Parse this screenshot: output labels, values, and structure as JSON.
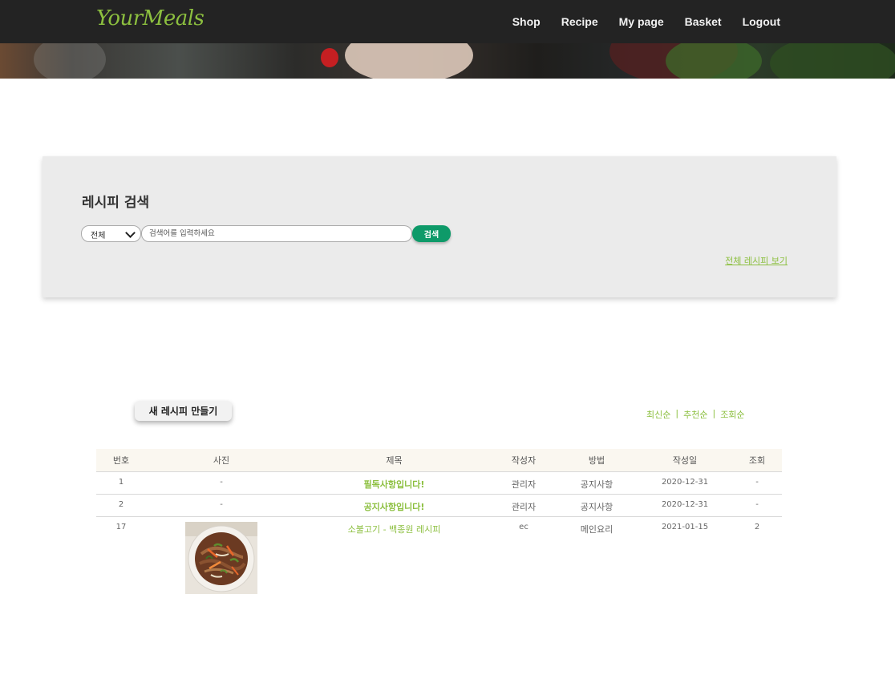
{
  "brand": {
    "logo": "YourMeals",
    "accent": "#8cbf3f",
    "button_green": "#0e9a69",
    "notice_red": "#e0405a"
  },
  "nav": {
    "items": [
      {
        "label": "Shop"
      },
      {
        "label": "Recipe"
      },
      {
        "label": "My page"
      },
      {
        "label": "Basket"
      },
      {
        "label": "Logout"
      }
    ]
  },
  "search": {
    "title": "레시피 검색",
    "category_selected": "전체",
    "placeholder": "검색어를 입력하세요",
    "button_label": "검색",
    "all_recipes_link": "전체 레시피 보기"
  },
  "list": {
    "new_recipe_button": "새 레시피 만들기",
    "sort": [
      {
        "label": "최신순"
      },
      {
        "label": "추천순"
      },
      {
        "label": "조회순"
      }
    ],
    "sort_separator": "|",
    "columns": [
      "번호",
      "사진",
      "제목",
      "작성자",
      "방법",
      "작성일",
      "조회"
    ],
    "rows": [
      {
        "num": "1",
        "photo": "-",
        "title": "필독사항입니다!",
        "author": "관리자",
        "method": "공지사항",
        "date": "2020-12-31",
        "views": "-"
      },
      {
        "num": "2",
        "photo": "-",
        "title": "공지사항입니다!",
        "author": "관리자",
        "method": "공지사항",
        "date": "2020-12-31",
        "views": "-"
      },
      {
        "num": "17",
        "photo_icon": "bulgogi-dish-photo",
        "title": "소불고기 - 백종원 레시피",
        "author": "ec",
        "method": "메인요리",
        "date": "2021-01-15",
        "views": "2"
      }
    ]
  }
}
